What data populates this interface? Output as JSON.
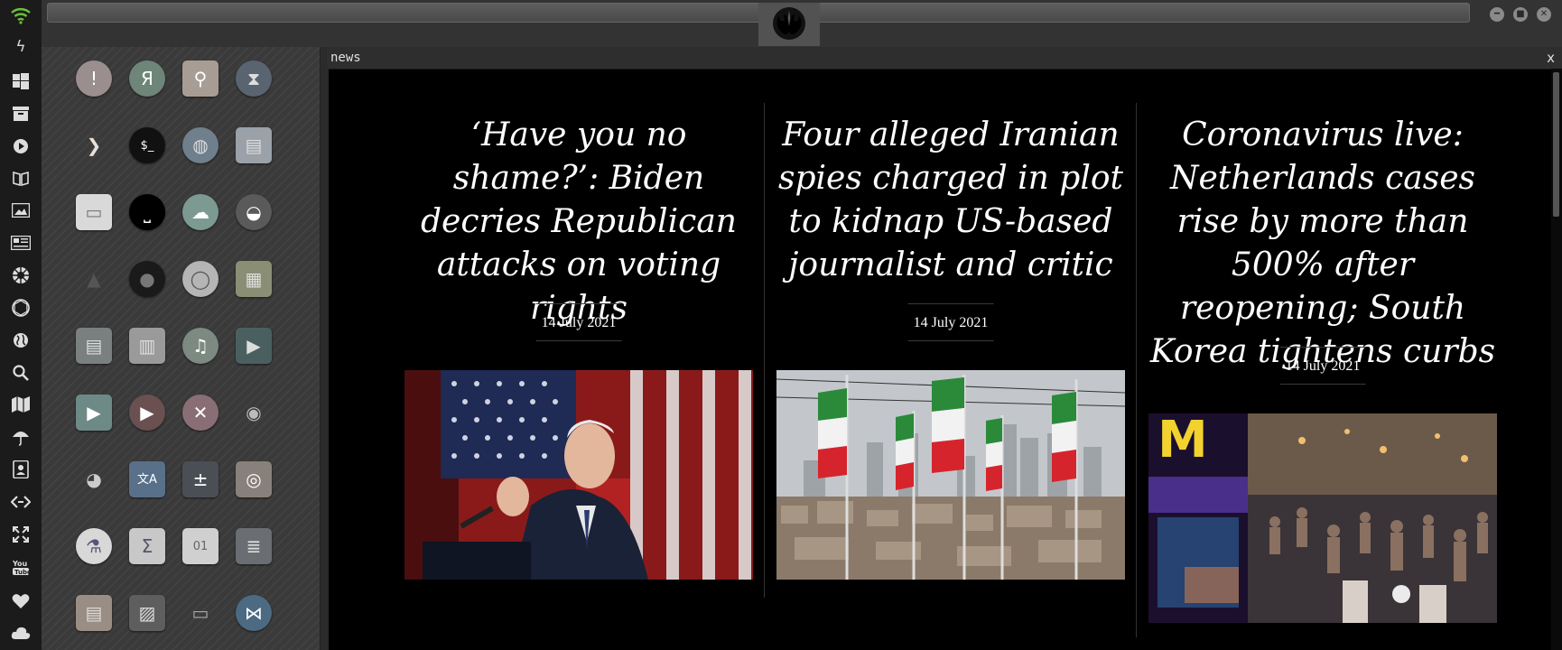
{
  "dock": {
    "icons": [
      "wifi-icon",
      "lightning-icon",
      "windows-icon",
      "archive-icon",
      "play-circle-icon",
      "books-icon",
      "image-icon",
      "newspaper-icon",
      "rebel-alliance-icon",
      "empire-icon",
      "globe-icon",
      "search-icon",
      "map-icon",
      "umbrella-icon",
      "contacts-icon",
      "code-icon",
      "fullscreen-icon",
      "youtube-icon",
      "heart-icon",
      "cloud-icon"
    ]
  },
  "launcher": {
    "apps": [
      "warning-app-icon",
      "yandex-app-icon",
      "search-app-icon",
      "hourglass-app-icon",
      "forward-app-icon",
      "terminal-app-icon",
      "globe-app-icon",
      "file-cabinet-app-icon",
      "window-app-icon",
      "bed-app-icon",
      "cloud-lock-app-icon",
      "github-app-icon",
      "starfleet-app-icon",
      "death-star-app-icon",
      "wikipedia-app-icon",
      "world-map-app-icon",
      "documents-app-icon",
      "notebook-app-icon",
      "music-app-icon",
      "video-app-icon",
      "play-app-icon",
      "youtube-app-icon",
      "close-app-icon",
      "droid-app-icon",
      "c3po-app-icon",
      "translate-app-icon",
      "calculator-app-icon",
      "camera-app-icon",
      "flask-app-icon",
      "sigma-app-icon",
      "binary-app-icon",
      "text-editor-app-icon",
      "document-app-icon",
      "image-viewer-app-icon",
      "presentation-app-icon",
      "vscode-app-icon"
    ],
    "glyphs": [
      "!",
      "Я",
      "⚲",
      "⧗",
      "❯",
      "$_",
      "◍",
      "▤",
      "▭",
      "⎵",
      "☁",
      "◒",
      "▲",
      "●",
      "◯",
      "▦",
      "▤",
      "▥",
      "♫",
      "▶",
      "▶",
      "▶",
      "✕",
      "◉",
      "◕",
      "文A",
      "±",
      "◎",
      "⚗",
      "Σ",
      "01",
      "≣",
      "▤",
      "▨",
      "▭",
      "⋈"
    ]
  },
  "window": {
    "title": "news",
    "close_label": "x",
    "logo": "rebel-alliance-logo"
  },
  "articles": [
    {
      "headline": "‘Have you no shame?’: Biden decries Republican attacks on voting rights",
      "date": "14 July 2021",
      "image": "biden-speaking-photo"
    },
    {
      "headline": "Four alleged Iranian spies charged in plot to kidnap US-based journalist and critic",
      "date": "14 July 2021",
      "image": "iranian-flags-photo"
    },
    {
      "headline": "Coronavirus live: Netherlands cases rise by more than 500% after reopening; South Korea tightens curbs",
      "date": "14 July 2021",
      "image": "amsterdam-street-photo"
    }
  ],
  "colors": {
    "accent_wifi": "#6dbf3b",
    "news_bg": "#000000",
    "headline": "#ffffff"
  }
}
